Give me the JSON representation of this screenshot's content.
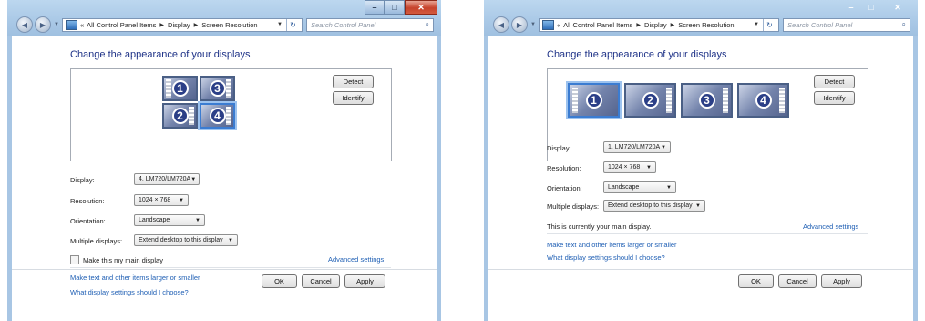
{
  "windows": [
    {
      "address": {
        "items": [
          "All Control Panel Items",
          "Display",
          "Screen Resolution"
        ],
        "prefix": "«"
      },
      "search_placeholder": "Search Control Panel",
      "heading": "Change the appearance of your displays",
      "buttons": {
        "detect": "Detect",
        "identify": "Identify",
        "ok": "OK",
        "cancel": "Cancel",
        "apply": "Apply"
      },
      "monitors": [
        "1",
        "3",
        "2",
        "4"
      ],
      "selected_monitor": "4",
      "fields": {
        "display_label": "Display:",
        "display_value": "4. LM720/LM720A",
        "resolution_label": "Resolution:",
        "resolution_value": "1024 × 768",
        "orientation_label": "Orientation:",
        "orientation_value": "Landscape",
        "multiple_label": "Multiple displays:",
        "multiple_value": "Extend desktop to this display"
      },
      "main_display_text": "Make this my main display",
      "main_display_checked": false,
      "advanced_link": "Advanced settings",
      "links": [
        "Make text and other items larger or smaller",
        "What display settings should I choose?"
      ]
    },
    {
      "address": {
        "items": [
          "All Control Panel Items",
          "Display",
          "Screen Resolution"
        ],
        "prefix": "«"
      },
      "search_placeholder": "Search Control Panel",
      "heading": "Change the appearance of your displays",
      "buttons": {
        "detect": "Detect",
        "identify": "Identify",
        "ok": "OK",
        "cancel": "Cancel",
        "apply": "Apply"
      },
      "monitors": [
        "1",
        "2",
        "3",
        "4"
      ],
      "selected_monitor": "1",
      "fields": {
        "display_label": "Display:",
        "display_value": "1. LM720/LM720A",
        "resolution_label": "Resolution:",
        "resolution_value": "1024 × 768",
        "orientation_label": "Orientation:",
        "orientation_value": "Landscape",
        "multiple_label": "Multiple displays:",
        "multiple_value": "Extend desktop to this display"
      },
      "main_display_text": "This is currently your main display.",
      "advanced_link": "Advanced settings",
      "links": [
        "Make text and other items larger or smaller",
        "What display settings should I choose?"
      ]
    }
  ],
  "colors": {
    "heading": "#1e3287",
    "link": "#1f5fb4",
    "chrome": "#a9c8e6",
    "selected_monitor": "#3b7cd1"
  },
  "icons": [
    "back-icon",
    "forward-icon",
    "control-panel-icon",
    "refresh-icon",
    "search-icon",
    "minimize-icon",
    "maximize-icon",
    "close-icon",
    "monitor-icon"
  ]
}
